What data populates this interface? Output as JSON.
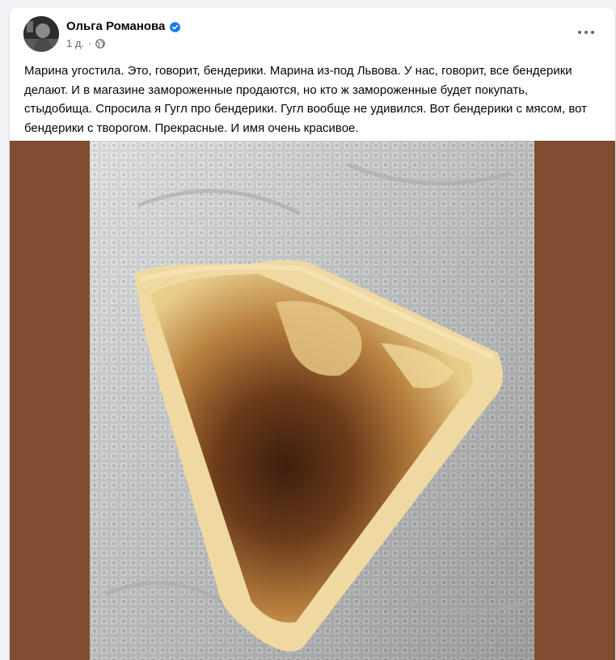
{
  "post": {
    "author_name": "Ольга Романова",
    "time_ago": "1 д.",
    "text": "Марина угостила. Это, говорит, бендерики. Марина из-под Львова. У нас, говорит, все бендерики делают. И в магазине замороженные продаются, но кто ж замороженные будет покупать, стыдобища. Спросила я Гугл про бендерики. Гугл вообще не удивился. Вот бендерики с мясом, вот бендерики с творогом.  Прекрасные. И имя очень красивое."
  },
  "icons": {
    "verified": "verified-badge-icon",
    "privacy": "globe-icon",
    "more": "more-options-icon"
  },
  "colors": {
    "verified_blue": "#1877f2",
    "photo_background": "#804d30",
    "secondary_text": "#65676b"
  }
}
